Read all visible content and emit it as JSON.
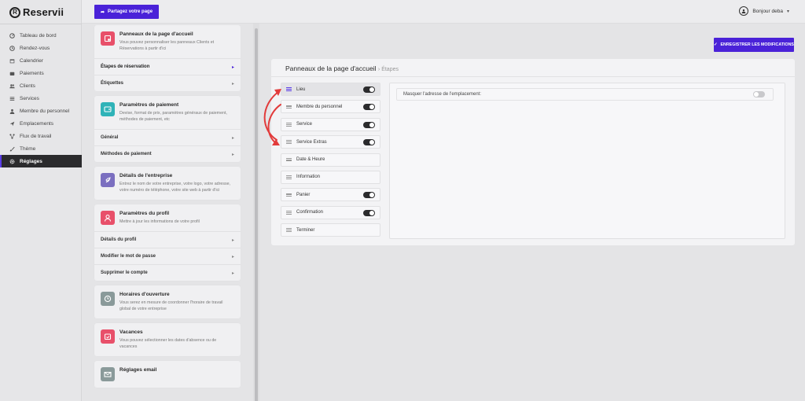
{
  "brand": {
    "name": "Reservii",
    "mark": "R"
  },
  "nav": [
    {
      "id": "dashboard",
      "label": "Tableau de bord",
      "icon": "dashboard-icon"
    },
    {
      "id": "appointments",
      "label": "Rendez-vous",
      "icon": "clock-icon"
    },
    {
      "id": "calendar",
      "label": "Calendrier",
      "icon": "calendar-icon"
    },
    {
      "id": "payments",
      "label": "Paiements",
      "icon": "wallet-icon"
    },
    {
      "id": "clients",
      "label": "Clients",
      "icon": "users-icon"
    },
    {
      "id": "services",
      "label": "Services",
      "icon": "list-icon"
    },
    {
      "id": "staff",
      "label": "Membre du personnel",
      "icon": "user-icon"
    },
    {
      "id": "locations",
      "label": "Emplacements",
      "icon": "send-icon"
    },
    {
      "id": "workflows",
      "label": "Flux de travail",
      "icon": "flow-icon"
    },
    {
      "id": "theme",
      "label": "Thème",
      "icon": "brush-icon"
    },
    {
      "id": "settings",
      "label": "Réglages",
      "icon": "gear-icon",
      "active": true
    }
  ],
  "topbar": {
    "share_label": "Partagez votre page",
    "greeting": "Bonjour deba"
  },
  "settings_cards": [
    {
      "id": "front-panels",
      "title": "Panneaux de la page d'accueil",
      "desc": "Vous pouvez personnaliser les panneaux Clients et Réservations à partir d'ici",
      "icon_color": "#e8506a",
      "rows": [
        {
          "label": "Étapes de réservation",
          "selected": true
        },
        {
          "label": "Étiquettes"
        }
      ]
    },
    {
      "id": "payment",
      "title": "Paramètres de paiement",
      "desc": "Devise, format de prix, paramètres généraux de paiement, méthodes de paiement, etc",
      "icon_color": "#2fb3b8",
      "rows": [
        {
          "label": "Général"
        },
        {
          "label": "Méthodes de paiement"
        }
      ]
    },
    {
      "id": "company",
      "title": "Détails de l'entreprise",
      "desc": "Entrez le nom de votre entreprise, votre logo, votre adresse, votre numéro de téléphone, votre site web à partir d'ici",
      "icon_color": "#7b6fc0",
      "rows": []
    },
    {
      "id": "profile",
      "title": "Paramètres du profil",
      "desc": "Mettre à jour les informations de votre profil",
      "icon_color": "#e8506a",
      "rows": [
        {
          "label": "Détails du profil"
        },
        {
          "label": "Modifier le mot de passe"
        },
        {
          "label": "Supprimer le compte"
        }
      ]
    },
    {
      "id": "hours",
      "title": "Horaires d'ouverture",
      "desc": "Vous serez en mesure de coordonner l'horaire de travail global de votre entreprise",
      "icon_color": "#8a9a9a",
      "rows": []
    },
    {
      "id": "holidays",
      "title": "Vacances",
      "desc": "Vous pouvez sélectionner les dates d'absence ou de vacances",
      "icon_color": "#e8506a",
      "rows": []
    },
    {
      "id": "email",
      "title": "Réglages email",
      "desc": "",
      "icon_color": "#8a9a9a",
      "rows": []
    }
  ],
  "main": {
    "save_label": "ENREGISTRER LES MODIFICATIONS",
    "title": "Panneaux de la page d'accueil",
    "subtitle": "Étapes",
    "steps": [
      {
        "label": "Lieu",
        "toggle": true,
        "active": true
      },
      {
        "label": "Membre du personnel",
        "toggle": true
      },
      {
        "label": "Service",
        "toggle": true
      },
      {
        "label": "Service Extras",
        "toggle": true
      },
      {
        "label": "Date & Heure",
        "toggle": false
      },
      {
        "label": "Information",
        "toggle": false
      },
      {
        "label": "Panier",
        "toggle": true
      },
      {
        "label": "Confirmation",
        "toggle": true
      },
      {
        "label": "Terminer",
        "toggle": false
      }
    ],
    "detail_option": {
      "label": "Masquer l'adresse de l'emplacement:",
      "enabled": false
    }
  },
  "colors": {
    "accent": "#4a22d8",
    "annotation": "#e23b3b",
    "sidebar_active": "#2b2b2d"
  }
}
